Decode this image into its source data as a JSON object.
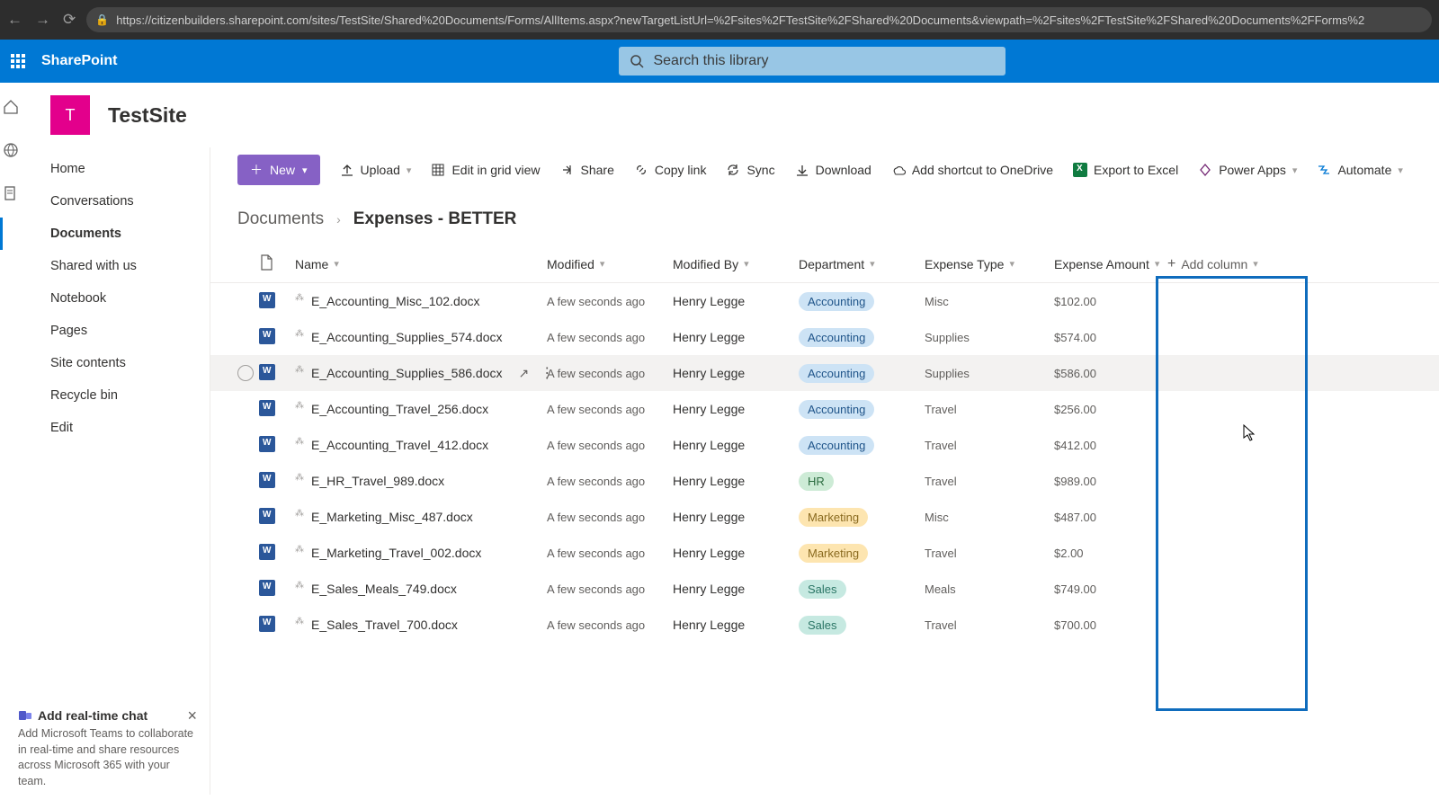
{
  "browser": {
    "url": "https://citizenbuilders.sharepoint.com/sites/TestSite/Shared%20Documents/Forms/AllItems.aspx?newTargetListUrl=%2Fsites%2FTestSite%2FShared%20Documents&viewpath=%2Fsites%2FTestSite%2FShared%20Documents%2FForms%2"
  },
  "brand": "SharePoint",
  "search": {
    "placeholder": "Search this library"
  },
  "site": {
    "initial": "T",
    "title": "TestSite"
  },
  "nav": {
    "items": [
      "Home",
      "Conversations",
      "Documents",
      "Shared with us",
      "Notebook",
      "Pages",
      "Site contents",
      "Recycle bin",
      "Edit"
    ],
    "selectedIndex": 2
  },
  "promo": {
    "title": "Add real-time chat",
    "body": "Add Microsoft Teams to collaborate in real-time and share resources across Microsoft 365 with your team."
  },
  "commands": {
    "new": "New",
    "items": [
      "Upload",
      "Edit in grid view",
      "Share",
      "Copy link",
      "Sync",
      "Download",
      "Add shortcut to OneDrive",
      "Export to Excel",
      "Power Apps",
      "Automate"
    ]
  },
  "breadcrumb": {
    "root": "Documents",
    "current": "Expenses - BETTER"
  },
  "columns": {
    "name": "Name",
    "modified": "Modified",
    "modifiedBy": "Modified By",
    "department": "Department",
    "expenseType": "Expense Type",
    "expenseAmount": "Expense Amount",
    "addColumn": "Add column"
  },
  "rows": [
    {
      "name": "E_Accounting_Misc_102.docx",
      "modified": "A few seconds ago",
      "by": "Henry Legge",
      "dept": "Accounting",
      "type": "Misc",
      "amount": "$102.00"
    },
    {
      "name": "E_Accounting_Supplies_574.docx",
      "modified": "A few seconds ago",
      "by": "Henry Legge",
      "dept": "Accounting",
      "type": "Supplies",
      "amount": "$574.00"
    },
    {
      "name": "E_Accounting_Supplies_586.docx",
      "modified": "A few seconds ago",
      "by": "Henry Legge",
      "dept": "Accounting",
      "type": "Supplies",
      "amount": "$586.00",
      "hovered": true
    },
    {
      "name": "E_Accounting_Travel_256.docx",
      "modified": "A few seconds ago",
      "by": "Henry Legge",
      "dept": "Accounting",
      "type": "Travel",
      "amount": "$256.00"
    },
    {
      "name": "E_Accounting_Travel_412.docx",
      "modified": "A few seconds ago",
      "by": "Henry Legge",
      "dept": "Accounting",
      "type": "Travel",
      "amount": "$412.00"
    },
    {
      "name": "E_HR_Travel_989.docx",
      "modified": "A few seconds ago",
      "by": "Henry Legge",
      "dept": "HR",
      "type": "Travel",
      "amount": "$989.00"
    },
    {
      "name": "E_Marketing_Misc_487.docx",
      "modified": "A few seconds ago",
      "by": "Henry Legge",
      "dept": "Marketing",
      "type": "Misc",
      "amount": "$487.00"
    },
    {
      "name": "E_Marketing_Travel_002.docx",
      "modified": "A few seconds ago",
      "by": "Henry Legge",
      "dept": "Marketing",
      "type": "Travel",
      "amount": "$2.00"
    },
    {
      "name": "E_Sales_Meals_749.docx",
      "modified": "A few seconds ago",
      "by": "Henry Legge",
      "dept": "Sales",
      "type": "Meals",
      "amount": "$749.00"
    },
    {
      "name": "E_Sales_Travel_700.docx",
      "modified": "A few seconds ago",
      "by": "Henry Legge",
      "dept": "Sales",
      "type": "Travel",
      "amount": "$700.00"
    }
  ]
}
